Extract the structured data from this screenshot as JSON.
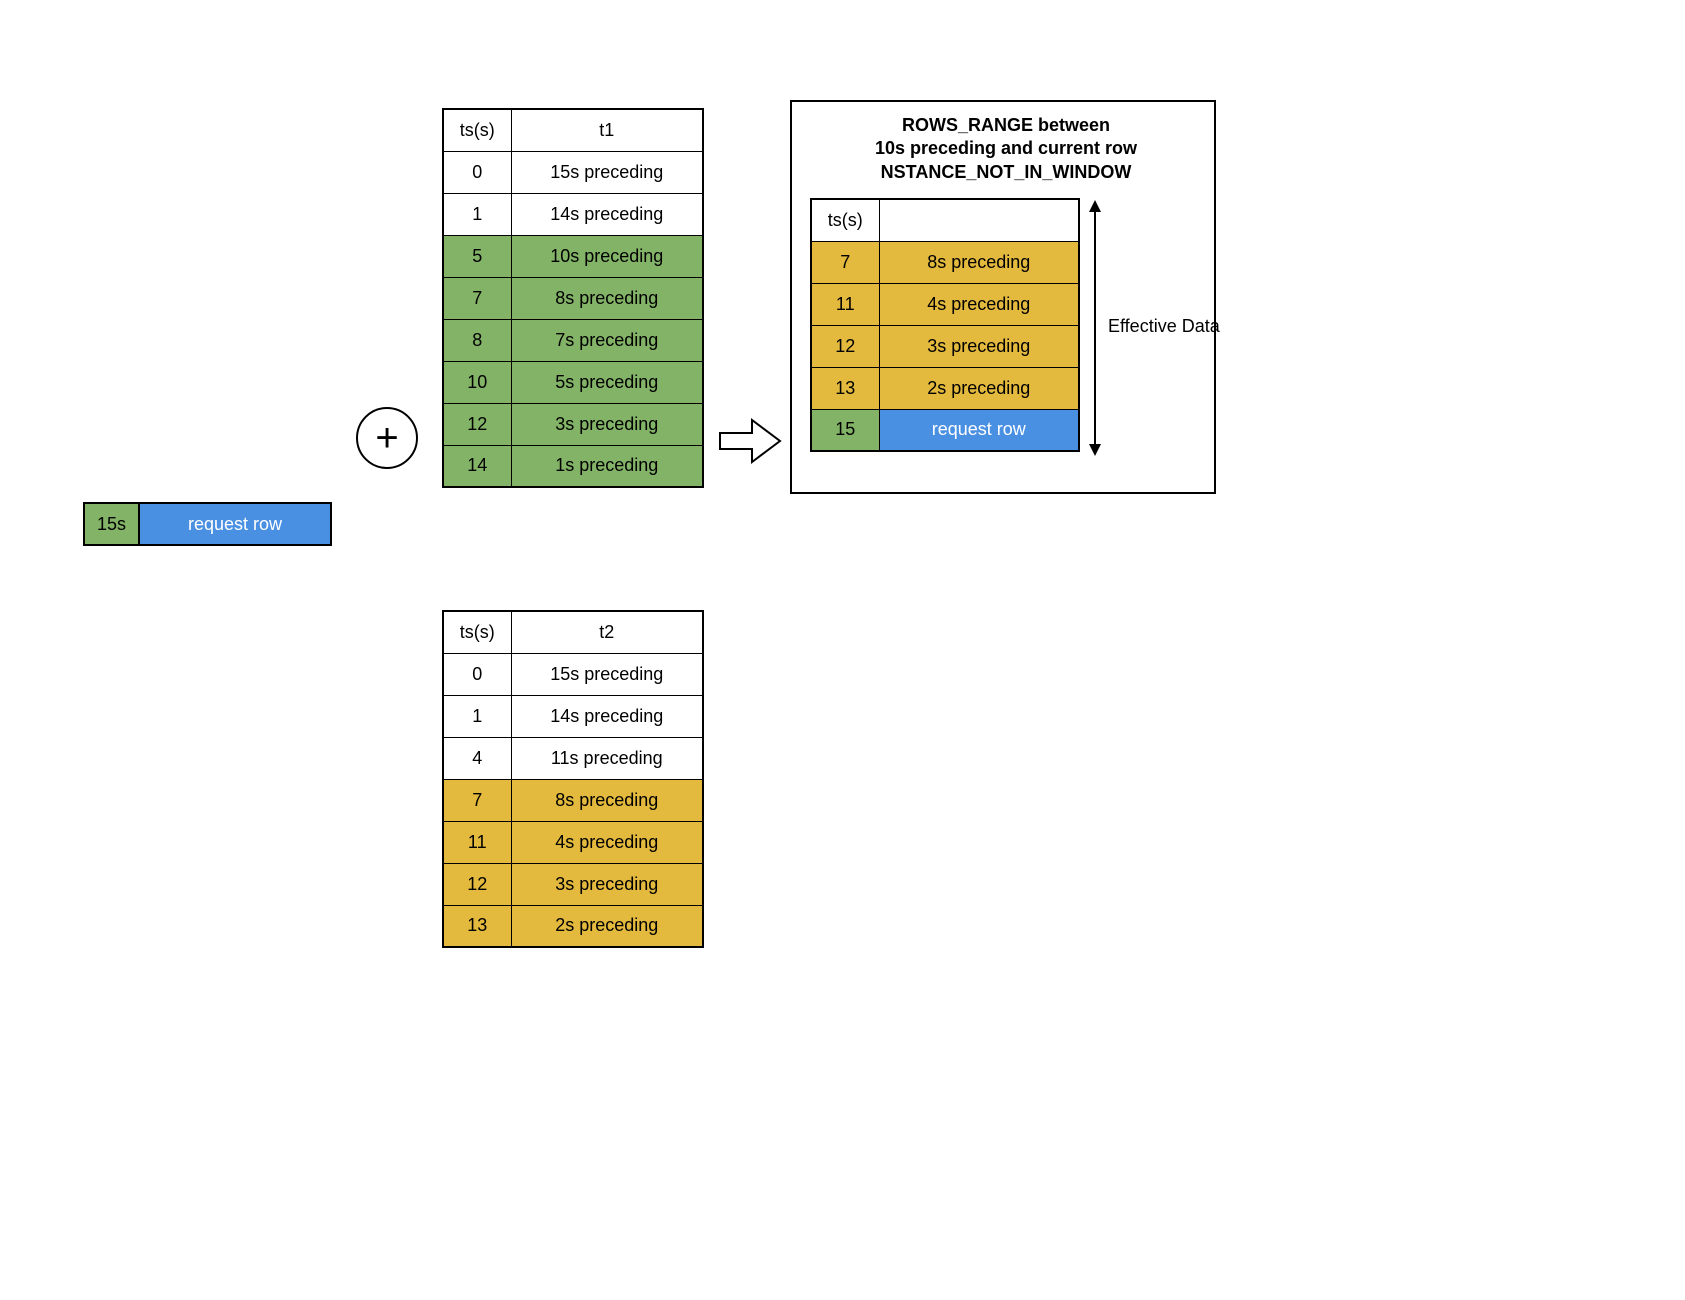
{
  "colors": {
    "green": "#82b366",
    "yellow": "#e3b93e",
    "blue": "#4a90e2"
  },
  "request_row": {
    "ts": "15s",
    "label": "request row"
  },
  "t1": {
    "header_ts": "ts(s)",
    "header_val": "t1",
    "rows": [
      {
        "ts": "0",
        "val": "15s preceding",
        "color": "white"
      },
      {
        "ts": "1",
        "val": "14s preceding",
        "color": "white"
      },
      {
        "ts": "5",
        "val": "10s preceding",
        "color": "green"
      },
      {
        "ts": "7",
        "val": "8s preceding",
        "color": "green"
      },
      {
        "ts": "8",
        "val": "7s preceding",
        "color": "green"
      },
      {
        "ts": "10",
        "val": "5s preceding",
        "color": "green"
      },
      {
        "ts": "12",
        "val": "3s preceding",
        "color": "green"
      },
      {
        "ts": "14",
        "val": "1s preceding",
        "color": "green"
      }
    ]
  },
  "t2": {
    "header_ts": "ts(s)",
    "header_val": "t2",
    "rows": [
      {
        "ts": "0",
        "val": "15s preceding",
        "color": "white"
      },
      {
        "ts": "1",
        "val": "14s preceding",
        "color": "white"
      },
      {
        "ts": "4",
        "val": "11s preceding",
        "color": "white"
      },
      {
        "ts": "7",
        "val": "8s preceding",
        "color": "yellow"
      },
      {
        "ts": "11",
        "val": "4s preceding",
        "color": "yellow"
      },
      {
        "ts": "12",
        "val": "3s preceding",
        "color": "yellow"
      },
      {
        "ts": "13",
        "val": "2s preceding",
        "color": "yellow"
      }
    ]
  },
  "output": {
    "title": "ROWS_RANGE between\n10s preceding and current row\nNSTANCE_NOT_IN_WINDOW",
    "header_ts": "ts(s)",
    "header_val": "",
    "rows": [
      {
        "ts": "7",
        "ts_color": "yellow",
        "val": "8s preceding",
        "val_color": "yellow"
      },
      {
        "ts": "11",
        "ts_color": "yellow",
        "val": "4s preceding",
        "val_color": "yellow"
      },
      {
        "ts": "12",
        "ts_color": "yellow",
        "val": "3s preceding",
        "val_color": "yellow"
      },
      {
        "ts": "13",
        "ts_color": "yellow",
        "val": "2s preceding",
        "val_color": "yellow"
      },
      {
        "ts": "15",
        "ts_color": "green",
        "val": "request row",
        "val_color": "blue"
      }
    ],
    "effective_label": "Effective Data"
  }
}
